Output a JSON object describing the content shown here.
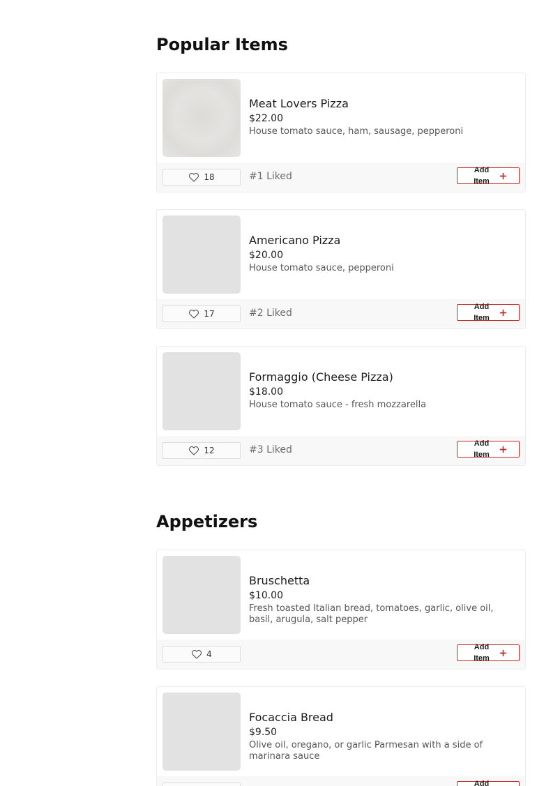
{
  "sections": [
    {
      "title": "Popular Items",
      "items": [
        {
          "name": "Meat Lovers Pizza",
          "price": "$22.00",
          "description": "House tomato sauce, ham, sausage, pepperoni",
          "likes": "18",
          "rank": "#1 Liked",
          "add_label": "Add Item"
        },
        {
          "name": "Americano Pizza",
          "price": "$20.00",
          "description": "House tomato sauce, pepperoni",
          "likes": "17",
          "rank": "#2 Liked",
          "add_label": "Add Item"
        },
        {
          "name": "Formaggio (Cheese Pizza)",
          "price": "$18.00",
          "description": "House tomato sauce - fresh mozzarella",
          "likes": "12",
          "rank": "#3 Liked",
          "add_label": "Add Item"
        }
      ]
    },
    {
      "title": "Appetizers",
      "items": [
        {
          "name": "Bruschetta",
          "price": "$10.00",
          "description": "Fresh toasted Italian bread, tomatoes, garlic, olive oil, basil, arugula, salt pepper",
          "likes": "4",
          "add_label": "Add Item"
        },
        {
          "name": "Focaccia Bread",
          "price": "$9.50",
          "description": "Olive oil, oregano, or garlic Parmesan with a side of marinara sauce",
          "add_label": "Add Item"
        }
      ]
    }
  ],
  "colors": {
    "accent": "#c62828",
    "footer_bg": "#f8f8f8",
    "placeholder": "#e2e2e2"
  },
  "icons": {
    "like": "heart-icon",
    "add": "plus-icon"
  }
}
